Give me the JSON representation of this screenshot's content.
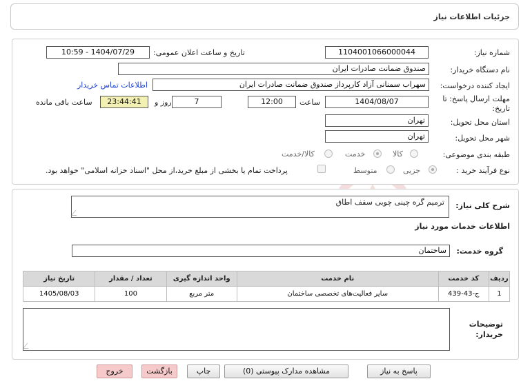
{
  "header": {
    "title": "جزئیات اطلاعات نیاز"
  },
  "form": {
    "need_number_label": "شماره نیاز:",
    "need_number": "1104001066000044",
    "announce_label": "تاریخ و ساعت اعلان عمومی:",
    "announce_value": "1404/07/29 - 10:59",
    "buyer_label": "نام دستگاه خریدار:",
    "buyer_value": "صندوق ضمانت صادرات ایران",
    "creator_label": "ایجاد کننده درخواست:",
    "creator_value": "سهراب سمنانی آزاد کارپرداز صندوق ضمانت صادرات ایران",
    "contact_link": "اطلاعات تماس خریدار",
    "deadline_label_line1": "مهلت ارسال پاسخ: تا",
    "deadline_label_line2": "تاریخ:",
    "deadline_date": "1404/08/07",
    "time_label": "ساعت",
    "deadline_time": "12:00",
    "days_value": "7",
    "days_label": "روز و",
    "remaining_time": "23:44:41",
    "remaining_label": "ساعت باقی مانده",
    "province_label": "استان محل تحویل:",
    "province_value": "تهران",
    "city_label": "شهر محل تحویل:",
    "city_value": "تهران",
    "category_label": "طبقه بندی موضوعی:",
    "category_options": [
      "کالا",
      "خدمت",
      "کالا/خدمت"
    ],
    "category_selected": "خدمت",
    "process_label": "نوع فرآیند خرید :",
    "process_options": [
      "جزیی",
      "متوسط"
    ],
    "process_selected": "جزیی",
    "payment_note": "پرداخت تمام یا بخشی از مبلغ خرید،از محل \"اسناد خزانه اسلامی\" خواهد بود."
  },
  "details": {
    "summary_label": "شرح کلی نیاز:",
    "summary_value": "ترمیم گره چینی چوبی سقف اطاق",
    "services_heading": "اطلاعات خدمات مورد نیاز",
    "service_group_label": "گروه خدمت:",
    "service_group_value": "ساختمان",
    "table": {
      "headers": [
        "ردیف",
        "کد خدمت",
        "نام خدمت",
        "واحد اندازه گیری",
        "تعداد / مقدار",
        "تاریخ نیاز"
      ],
      "rows": [
        [
          "1",
          "ج-43-439",
          "سایر فعالیت‌های تخصصی ساختمان",
          "متر مربع",
          "100",
          "1405/08/03"
        ]
      ]
    },
    "buyer_notes_label_line1": "توضیحات",
    "buyer_notes_label_line2": "خریدار:",
    "buyer_notes_value": ""
  },
  "watermark": {
    "text": "AriaTender.net"
  },
  "buttons": {
    "reply": "پاسخ به نیاز",
    "attachments": "مشاهده مدارک پیوستی (0)",
    "print": "چاپ",
    "back": "بازگشت",
    "exit": "خروج"
  },
  "colors": {
    "remaining_bg": "#f3f0b4",
    "link": "#1a3fd6",
    "exit_bg": "#f6caca"
  }
}
